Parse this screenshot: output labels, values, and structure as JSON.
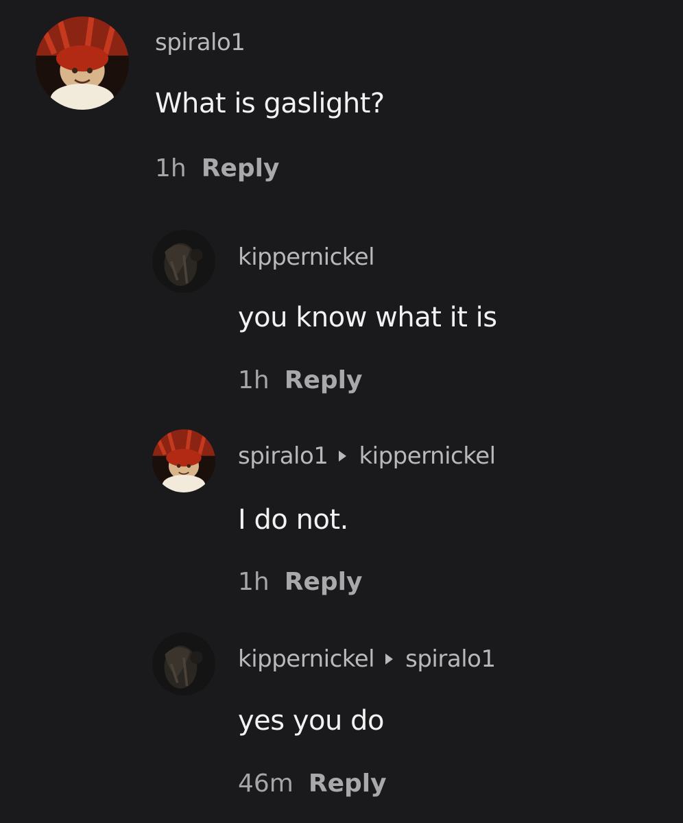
{
  "comments": [
    {
      "username": "spiralo1",
      "reply_to": "",
      "text": "What is gaslight?",
      "time": "1h",
      "reply_label": "Reply"
    },
    {
      "username": "kippernickel",
      "reply_to": "",
      "text": "you know what it is",
      "time": "1h",
      "reply_label": "Reply"
    },
    {
      "username": "spiralo1",
      "reply_to": "kippernickel",
      "text": "I do not.",
      "time": "1h",
      "reply_label": "Reply"
    },
    {
      "username": "kippernickel",
      "reply_to": "spiralo1",
      "text": "yes you do",
      "time": "46m",
      "reply_label": "Reply"
    }
  ],
  "colors": {
    "background": "#1a1a1c",
    "username": "#b9b9bb",
    "text": "#f2f2f2",
    "meta": "#a6a6a8"
  }
}
